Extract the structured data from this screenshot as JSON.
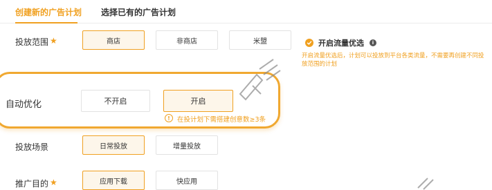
{
  "tabs": [
    {
      "label": "创建新的广告计划"
    },
    {
      "label": "选择已有的广告计划"
    }
  ],
  "placement_scope": {
    "label": "投放范围",
    "required_mark": "★",
    "options": [
      "商店",
      "非商店",
      "米盟"
    ],
    "selected": "商店"
  },
  "traffic_opt": {
    "label": "开启流量优选",
    "info_icon": "i",
    "description": "开启流量优选后，计划可以投放到平台各类流量，不需要再创建不同投放范围的计划"
  },
  "auto_opt": {
    "label": "自动优化",
    "options": [
      "不开启",
      "开启"
    ],
    "selected": "开启",
    "warning_icon": "!",
    "warning": "在投计划下需搭建创意数≥3条"
  },
  "scene": {
    "label": "投放场景",
    "options": [
      "日常投放",
      "增量投放"
    ],
    "selected": "日常投放"
  },
  "goal": {
    "label": "推广目的",
    "required_mark": "★",
    "options": [
      "应用下载",
      "快应用"
    ],
    "selected": "应用下载"
  },
  "colors": {
    "accent": "#f0a020",
    "highlight_border": "#f0a830"
  }
}
